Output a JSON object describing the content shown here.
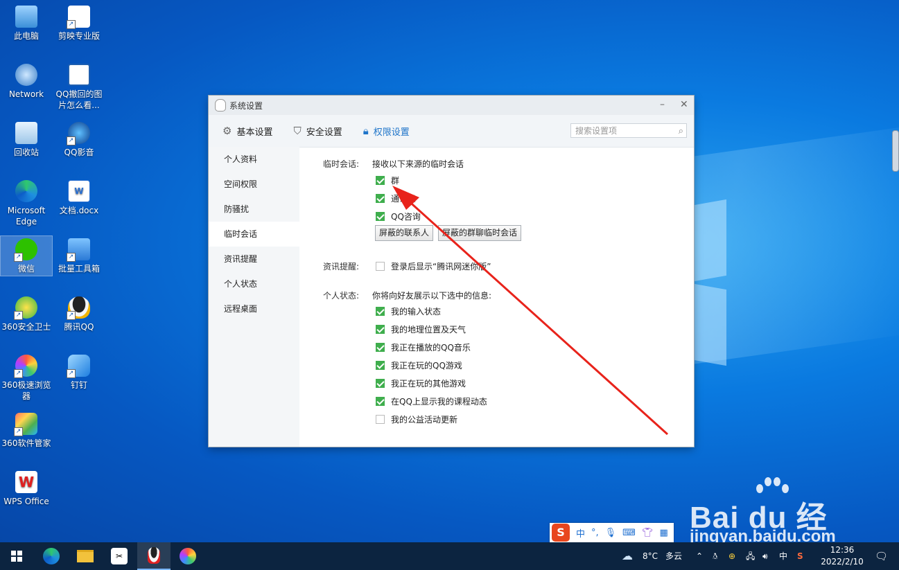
{
  "desktop": {
    "icons": [
      {
        "label": "此电脑",
        "icon": "computer-icon"
      },
      {
        "label": "剪映专业版",
        "icon": "capcut-icon"
      },
      {
        "label": "Network",
        "icon": "network-icon"
      },
      {
        "label": "QQ撤回的图片怎么看...",
        "icon": "document-icon"
      },
      {
        "label": "回收站",
        "icon": "recycle-bin-icon"
      },
      {
        "label": "QQ影音",
        "icon": "qq-player-icon"
      },
      {
        "label": "Microsoft Edge",
        "icon": "edge-icon"
      },
      {
        "label": "文档.docx",
        "icon": "word-doc-icon"
      },
      {
        "label": "微信",
        "icon": "wechat-icon"
      },
      {
        "label": "批量工具箱",
        "icon": "toolbox-icon"
      },
      {
        "label": "360安全卫士",
        "icon": "360-security-icon"
      },
      {
        "label": "腾讯QQ",
        "icon": "qq-icon"
      },
      {
        "label": "360极速浏览器",
        "icon": "360-browser-icon"
      },
      {
        "label": "钉钉",
        "icon": "dingtalk-icon"
      },
      {
        "label": "360软件管家",
        "icon": "360-software-icon"
      },
      {
        "label": "WPS Office",
        "icon": "wps-icon"
      }
    ]
  },
  "dialog": {
    "title": "系统设置",
    "minimize": "–",
    "close": "✕",
    "tabs": [
      {
        "label": "基本设置",
        "icon": "gear-icon"
      },
      {
        "label": "安全设置",
        "icon": "shield-icon"
      },
      {
        "label": "权限设置",
        "icon": "lock-icon"
      }
    ],
    "search_placeholder": "搜索设置项",
    "sidebar": [
      "个人资料",
      "空间权限",
      "防骚扰",
      "临时会话",
      "资讯提醒",
      "个人状态",
      "远程桌面"
    ],
    "temp_session": {
      "label": "临时会话:",
      "desc": "接收以下来源的临时会话",
      "options": [
        {
          "text": "群",
          "checked": true
        },
        {
          "text": "通讯录",
          "checked": true
        },
        {
          "text": "QQ咨询",
          "checked": true
        }
      ],
      "btn_blocked_contacts": "屏蔽的联系人",
      "btn_blocked_groups": "屏蔽的群聊临时会话"
    },
    "news": {
      "label": "资讯提醒:",
      "option": {
        "text": "登录后显示“腾讯网迷你版”",
        "checked": false
      }
    },
    "status": {
      "label": "个人状态:",
      "desc": "你将向好友展示以下选中的信息:",
      "options": [
        {
          "text": "我的输入状态",
          "checked": true
        },
        {
          "text": "我的地理位置及天气",
          "checked": true
        },
        {
          "text": "我正在播放的QQ音乐",
          "checked": true
        },
        {
          "text": "我正在玩的QQ游戏",
          "checked": true
        },
        {
          "text": "我正在玩的其他游戏",
          "checked": true
        },
        {
          "text": "在QQ上显示我的课程动态",
          "checked": true
        },
        {
          "text": "我的公益活动更新",
          "checked": false
        }
      ]
    }
  },
  "ime": {
    "logo": "S",
    "lang": "中",
    "punct": "°,"
  },
  "watermark": {
    "brand": "Bai du 经验",
    "url": "jingyan.baidu.com"
  },
  "taskbar": {
    "weather_temp": "8°C",
    "weather_text": "多云",
    "ime_lang": "中",
    "time": "12:36",
    "date": "2022/2/10"
  },
  "colors": {
    "accent": "#1e74c9",
    "check": "#3fae4d",
    "annotation": "#e8231b"
  }
}
